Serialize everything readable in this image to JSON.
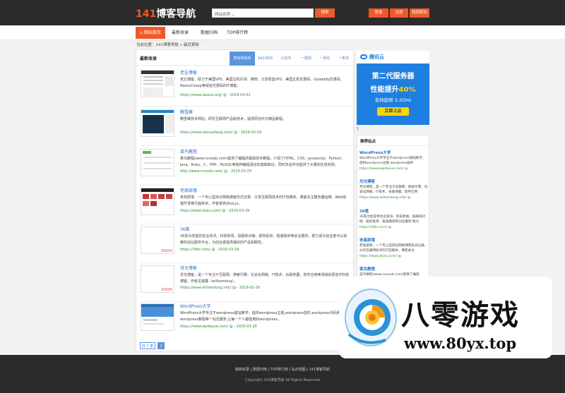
{
  "header": {
    "logo_num": "141",
    "logo_text": "博客导航",
    "search_type": "网站名称 ⌄",
    "search_btn": "搜索",
    "buttons": [
      "登录",
      "注册",
      "找回密码"
    ]
  },
  "nav": [
    "网站首页",
    "最新收录",
    "数据归档",
    "TOP排行榜"
  ],
  "breadcrumb": "当前位置：141博客导航 » 最近更新",
  "panel": {
    "title": "最新收录",
    "tabs": [
      "所有时间内",
      "24小时内",
      "三天内",
      "一周内",
      "一月内",
      "一年内"
    ]
  },
  "items": [
    {
      "title": "老左博客",
      "desc": "老左博客，助力于美国VPS、美国主机评测、推荐、分享便宜VPS、美国主机优惠码、Godaddy优惠码、NameCheap等域名优惠码的IT博客。",
      "url": "https://www.laozuo.org/ @ - 2019-04-01"
    },
    {
      "title": "腾雪峰",
      "desc": "腾雪峰技术网站，研究互联网产品和技术，提供原创中文精品教程。",
      "url": "https://www.liaoxuefeng.com/ @ - 2019-03-29"
    },
    {
      "title": "菜鸟教程",
      "desc": "菜鸟教程(www.runoob.com)提供了编程的基础技术教程，介绍了HTML、CSS、Javascript、Python、Java、Ruby、C、PHP、MySQL等各种编程语言的基础知识。同时本站中也提供了大量的在线实例。",
      "url": "http://www.runoob.com/ @ - 2019-03-29"
    },
    {
      "title": "老高部落",
      "desc": "老高部落：一个专心坚持记网络博客形式记录、分享互联网技术的IT自媒体，博客关注服务器运维、Web前端开发等方面技术，作者老高(BiuLu)。",
      "url": "https://www.ibulu.com/ @ - 2019-03-29"
    },
    {
      "title": "36氪",
      "desc": "36氪为您提供创业资讯、科技新闻、投融资对接、股权投资、极速融资等创业服务，致力成为创业者可以依赖的创业服务平台，为创业者提供最好的产品和服务。",
      "url": "https://36kr.com/ @ - 2019-03-29"
    },
    {
      "title": "月光博客",
      "desc": "月光博客，是一个专注于互联网、搜索引擎、社会化网络、IT技术、谷歌地图、软件应用等领域的原创IT科技博客，作者龙威廉（williamlong）。",
      "url": "https://www.williamlong.info/ @ - 2019-03-29"
    },
    {
      "title": "WordPress大学",
      "desc": "WordPress大学专注于wordpress建站教学，提供wordpress主题,wordpress插件,wordpress代码和wordpress教程等一站式服务,让每一个人都能用好wordpress。",
      "url": "https://www.wpdaxue.com/ @ - 2019-03-29"
    }
  ],
  "pager": {
    "count": "共 7 条",
    "page": "1"
  },
  "ad": {
    "brand": "腾讯云",
    "line1": "第二代服务器",
    "line2_a": "性能提升",
    "line2_b": "40%",
    "line3": "支持超频 3.2GHz",
    "btn": "立即上云",
    "num_below": "1"
  },
  "sidebar": {
    "title": "推荐站点",
    "items": [
      {
        "name": "WordPress大学",
        "desc": "WordPress大学专注于wordpress建站教学，提供wordpress主题,wordpress插件",
        "url": "https://www.wpdaxue.com/ @"
      },
      {
        "name": "月光博客",
        "desc": "月光博客，是一个专注于互联网、搜索引擎、社会化网络、IT技术、谷歌地图、软件应用",
        "url": "https://www.williamlong.info/ @"
      },
      {
        "name": "36氪",
        "desc": "36氪为您提供创业资讯、科技新闻、投融资对接、股权投资、极速融资等创业服务,致力",
        "url": "https://36kr.com/ @"
      },
      {
        "name": "老高部落",
        "desc": "老高部落：一个专心坚持记网络博客形式记录、分享互联网技术的IT自媒体，博客关注",
        "url": "https://www.ibulu.com/ @"
      },
      {
        "name": "菜鸟教程",
        "desc": "菜鸟教程(www.runoob.com)提供了编程",
        "url": ""
      }
    ]
  },
  "footer": {
    "links": "最新收录 | 数据归档 | TOP排行榜 | 站点地图 | 141博客导航",
    "copyright": "Copyright 141博客导航 All Rights Reserved"
  },
  "watermark": {
    "cn": "八零游戏",
    "url": "www.80yx.top"
  },
  "colors": {
    "brand": "#f05a28",
    "link": "#2a6fc9",
    "tab_active": "#5a96e0",
    "header_bg": "#2b2b2b",
    "ad_bg": "#1f7fe0"
  }
}
